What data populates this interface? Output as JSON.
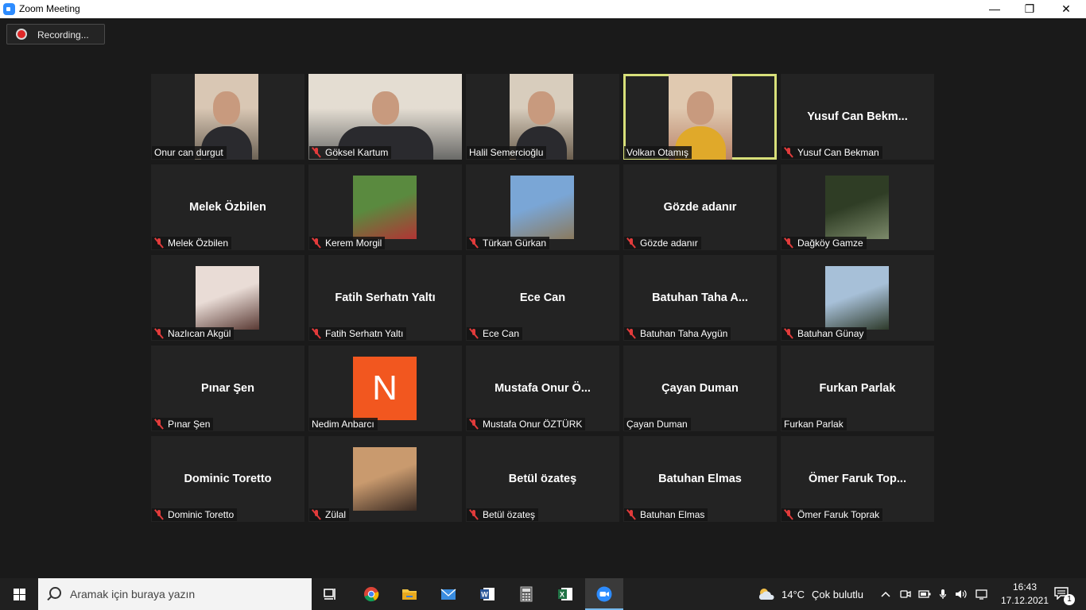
{
  "window": {
    "title": "Zoom Meeting",
    "minimize": "—",
    "restore": "❐",
    "close": "✕"
  },
  "recording": {
    "label": "Recording..."
  },
  "participants": [
    {
      "name": "Onur can durgut",
      "display": "",
      "muted": false,
      "type": "video",
      "video_colors": [
        "#6d6356",
        "#d9c7b4"
      ]
    },
    {
      "name": "Göksel Kartum",
      "display": "",
      "muted": true,
      "type": "video",
      "video_colors": [
        "#6a6a68",
        "#e4ddd2"
      ]
    },
    {
      "name": "Halil Semercioğlu",
      "display": "",
      "muted": false,
      "type": "video",
      "video_colors": [
        "#6b5e4e",
        "#d8cdbd"
      ]
    },
    {
      "name": "Volkan Otamış",
      "display": "",
      "muted": false,
      "type": "video",
      "video_colors": [
        "#b9846a",
        "#e0c9b0"
      ],
      "speaker": true
    },
    {
      "name": "Yusuf Can Bekman",
      "display": "Yusuf Can Bekm...",
      "muted": true,
      "type": "name"
    },
    {
      "name": "Melek Özbilen",
      "display": "Melek Özbilen",
      "muted": true,
      "type": "name"
    },
    {
      "name": "Kerem Morgil",
      "display": "",
      "muted": true,
      "type": "photo",
      "photo_colors": [
        "#5a8a3f",
        "#b23434"
      ]
    },
    {
      "name": "Türkan Gürkan",
      "display": "",
      "muted": true,
      "type": "photo",
      "photo_colors": [
        "#7aa6d6",
        "#8a7a5e"
      ]
    },
    {
      "name": "Gözde adanır",
      "display": "Gözde adanır",
      "muted": true,
      "type": "name"
    },
    {
      "name": "Dağköy Gamze",
      "display": "",
      "muted": true,
      "type": "photo",
      "photo_colors": [
        "#2f3d25",
        "#7c8a6a"
      ]
    },
    {
      "name": "Nazlıcan Akgül",
      "display": "",
      "muted": true,
      "type": "photo",
      "photo_colors": [
        "#e9dcd6",
        "#5a3a34"
      ]
    },
    {
      "name": "Fatih Serhatn Yaltı",
      "display": "Fatih Serhatn Yaltı",
      "muted": true,
      "type": "name"
    },
    {
      "name": "Ece Can",
      "display": "Ece Can",
      "muted": true,
      "type": "name"
    },
    {
      "name": "Batuhan Taha Aygün",
      "display": "Batuhan Taha A...",
      "muted": true,
      "type": "name"
    },
    {
      "name": "Batuhan Günay",
      "display": "",
      "muted": true,
      "type": "photo",
      "photo_colors": [
        "#a7c0d8",
        "#2e3a2a"
      ]
    },
    {
      "name": "Pınar Şen",
      "display": "Pınar Şen",
      "muted": true,
      "type": "name"
    },
    {
      "name": "Nedim Anbarcı",
      "display": "",
      "muted": false,
      "type": "letter",
      "letter": "N"
    },
    {
      "name": "Mustafa Onur ÖZTÜRK",
      "display": "Mustafa Onur Ö...",
      "muted": true,
      "type": "name"
    },
    {
      "name": "Çayan Duman",
      "display": "Çayan Duman",
      "muted": false,
      "type": "name"
    },
    {
      "name": "Furkan Parlak",
      "display": "Furkan Parlak",
      "muted": false,
      "type": "name"
    },
    {
      "name": "Dominic Toretto",
      "display": "Dominic Toretto",
      "muted": true,
      "type": "name"
    },
    {
      "name": "Zülal",
      "display": "",
      "muted": true,
      "type": "photo",
      "photo_colors": [
        "#c99a6e",
        "#3a2a22"
      ]
    },
    {
      "name": "Betül özateş",
      "display": "Betül özateş",
      "muted": true,
      "type": "name"
    },
    {
      "name": "Batuhan Elmas",
      "display": "Batuhan Elmas",
      "muted": true,
      "type": "name"
    },
    {
      "name": "Ömer Faruk Toprak",
      "display": "Ömer Faruk Top...",
      "muted": true,
      "type": "name"
    }
  ],
  "taskbar": {
    "search_placeholder": "Aramak için buraya yazın",
    "apps": [
      "task-view",
      "chrome",
      "file-explorer",
      "mail",
      "word",
      "calculator",
      "excel",
      "zoom"
    ],
    "weather": {
      "temp": "14°C",
      "desc": "Çok bulutlu"
    },
    "time": "16:43",
    "date": "17.12.2021",
    "notification_count": "1"
  },
  "colors": {
    "speaker_border": "#d8e07a",
    "muted_mic": "#e23b3b",
    "zoom_blue": "#2d8cff",
    "letter_avatar": "#f2571f"
  }
}
